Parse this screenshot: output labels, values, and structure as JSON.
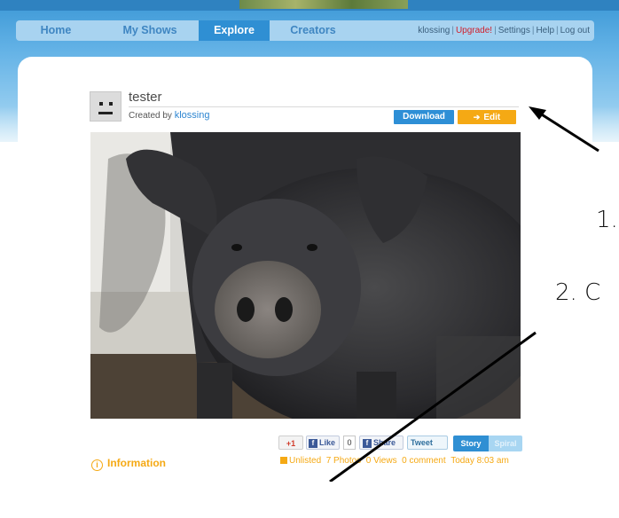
{
  "nav": {
    "items": [
      {
        "label": "Home"
      },
      {
        "label": "My Shows"
      },
      {
        "label": "Explore"
      },
      {
        "label": "Creators"
      }
    ],
    "active": "Explore",
    "user": "klossing",
    "upgrade": "Upgrade!",
    "settings": "Settings",
    "help": "Help",
    "logout": "Log out",
    "separator": "|"
  },
  "show": {
    "title": "tester",
    "created_by_prefix": "Created by",
    "creator": "klossing",
    "download_label": "Download",
    "edit_label": "Edit"
  },
  "social": {
    "gplus_label": "+1",
    "like_label": "Like",
    "like_count": "0",
    "share_label": "Share",
    "tweet_label": "Tweet"
  },
  "view_toggle": {
    "story_label": "Story",
    "spiral_label": "Spiral",
    "selected": "Story"
  },
  "stats": {
    "visibility": "Unlisted",
    "photos": "7 Photos",
    "views": "0 Views",
    "comments": "0 comment",
    "time": "Today 8:03 am"
  },
  "info_label": "Information",
  "annotations": {
    "step1": "1.",
    "step2": "2. C"
  },
  "colors": {
    "nav_active": "#2f8fd3",
    "nav_bar": "#a8d3f0",
    "download": "#2e8fd6",
    "edit": "#f5a914",
    "upgrade": "#d0202c",
    "accent_orange": "#f5a914"
  }
}
